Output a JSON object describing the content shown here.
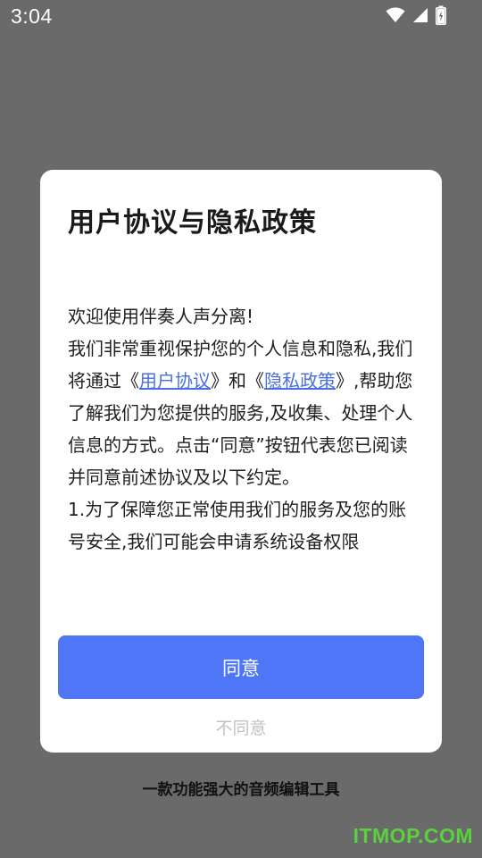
{
  "status_bar": {
    "time": "3:04",
    "icons": [
      "wifi-icon",
      "cell-signal-icon",
      "battery-charging-icon"
    ]
  },
  "dialog": {
    "title": "用户协议与隐私政策",
    "body": {
      "greeting": "欢迎使用伴奏人声分离!",
      "line1": "我们非常重视保护您的个人信息和隐私,",
      "line2_before": "我们将通过《",
      "user_agreement_link": "用户协议",
      "line2_middle": "》和《",
      "privacy_policy_link": "隐私政策",
      "line2_after": "》,帮助您了解我们为您提供的服务,及收集、处理个人信息的方式。点击“同意”按钮代表您已阅读并同意前述协议及以下约定。",
      "item1": "1.为了保障您正常使用我们的服务及您的账号安全,我们可能会申请系统设备权限"
    },
    "agree_label": "同意",
    "disagree_label": "不同意"
  },
  "tagline": "一款功能强大的音频编辑工具",
  "watermark": "ITMOP.COM",
  "colors": {
    "overlay": "#6a6a6a",
    "accent": "#4f76f6",
    "link": "#4a6fe3",
    "watermark": "#5ad13d"
  }
}
